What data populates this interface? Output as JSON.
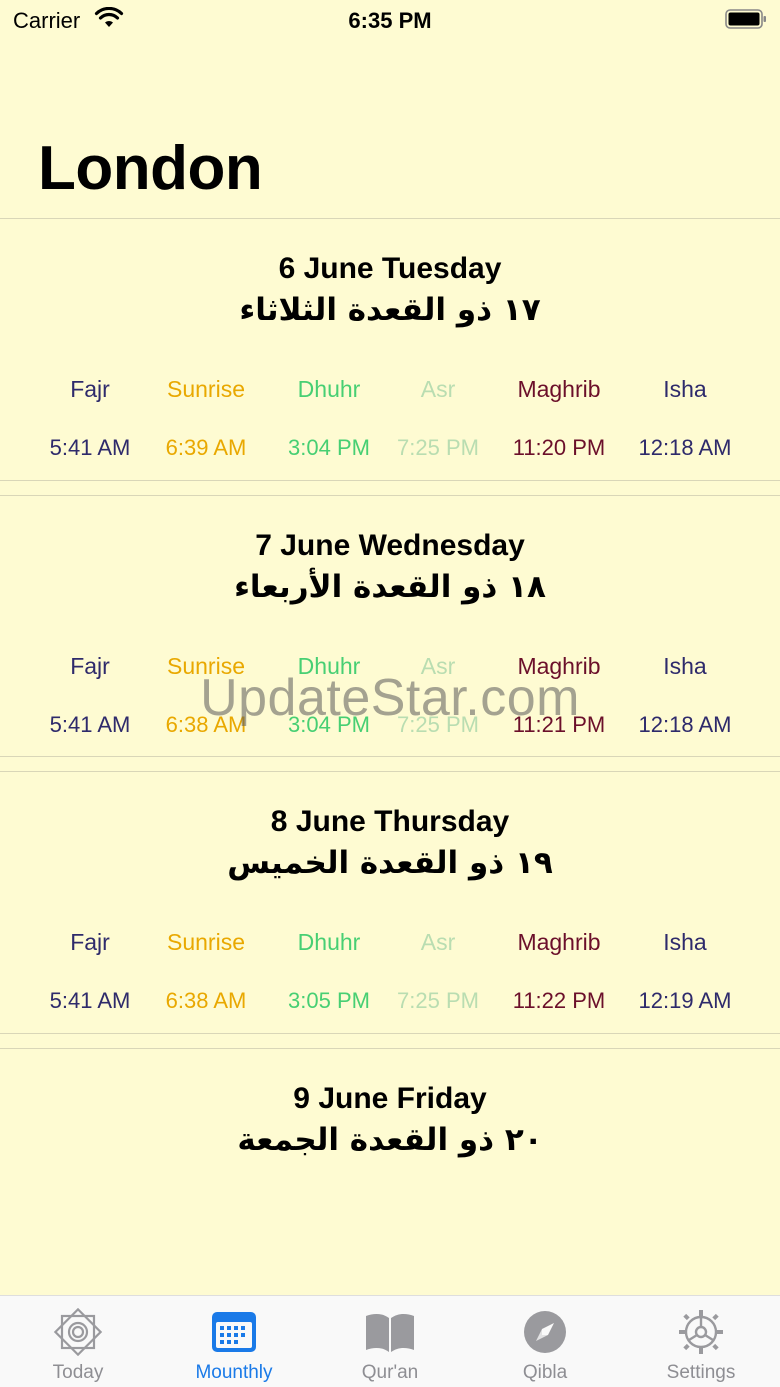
{
  "status_bar": {
    "carrier": "Carrier",
    "time": "6:35 PM"
  },
  "city": "London",
  "prayer_names": [
    "Fajr",
    "Sunrise",
    "Dhuhr",
    "Asr",
    "Maghrib",
    "Isha"
  ],
  "colors": {
    "background": "#fefbd2",
    "fajr": "#2e2a6b",
    "sunrise": "#e9a800",
    "dhuhr": "#47cf73",
    "asr": "#b9ddb1",
    "maghrib": "#6b0f2a",
    "isha": "#2e2a6b",
    "active_tab": "#1a7ae8"
  },
  "days": [
    {
      "gregorian": "6 June Tuesday",
      "hijri": "١٧ ذو القعدة الثلاثاء",
      "times": [
        "5:41 AM",
        "6:39 AM",
        "3:04 PM",
        "7:25 PM",
        "11:20 PM",
        "12:18 AM"
      ]
    },
    {
      "gregorian": "7 June Wednesday",
      "hijri": "١٨ ذو القعدة الأربعاء",
      "times": [
        "5:41 AM",
        "6:38 AM",
        "3:04 PM",
        "7:25 PM",
        "11:21 PM",
        "12:18 AM"
      ]
    },
    {
      "gregorian": "8 June Thursday",
      "hijri": "١٩ ذو القعدة الخميس",
      "times": [
        "5:41 AM",
        "6:38 AM",
        "3:05 PM",
        "7:25 PM",
        "11:22 PM",
        "12:19 AM"
      ]
    },
    {
      "gregorian": "9 June Friday",
      "hijri": "٢٠ ذو القعدة الجمعة"
    }
  ],
  "watermark": "UpdateStar.com",
  "tabs": [
    {
      "label": "Today",
      "icon": "star-octagon-icon"
    },
    {
      "label": "Mounthly",
      "icon": "calendar-icon"
    },
    {
      "label": "Qur'an",
      "icon": "book-icon"
    },
    {
      "label": "Qibla",
      "icon": "compass-icon"
    },
    {
      "label": "Settings",
      "icon": "gear-icon"
    }
  ],
  "active_tab": "Mounthly"
}
